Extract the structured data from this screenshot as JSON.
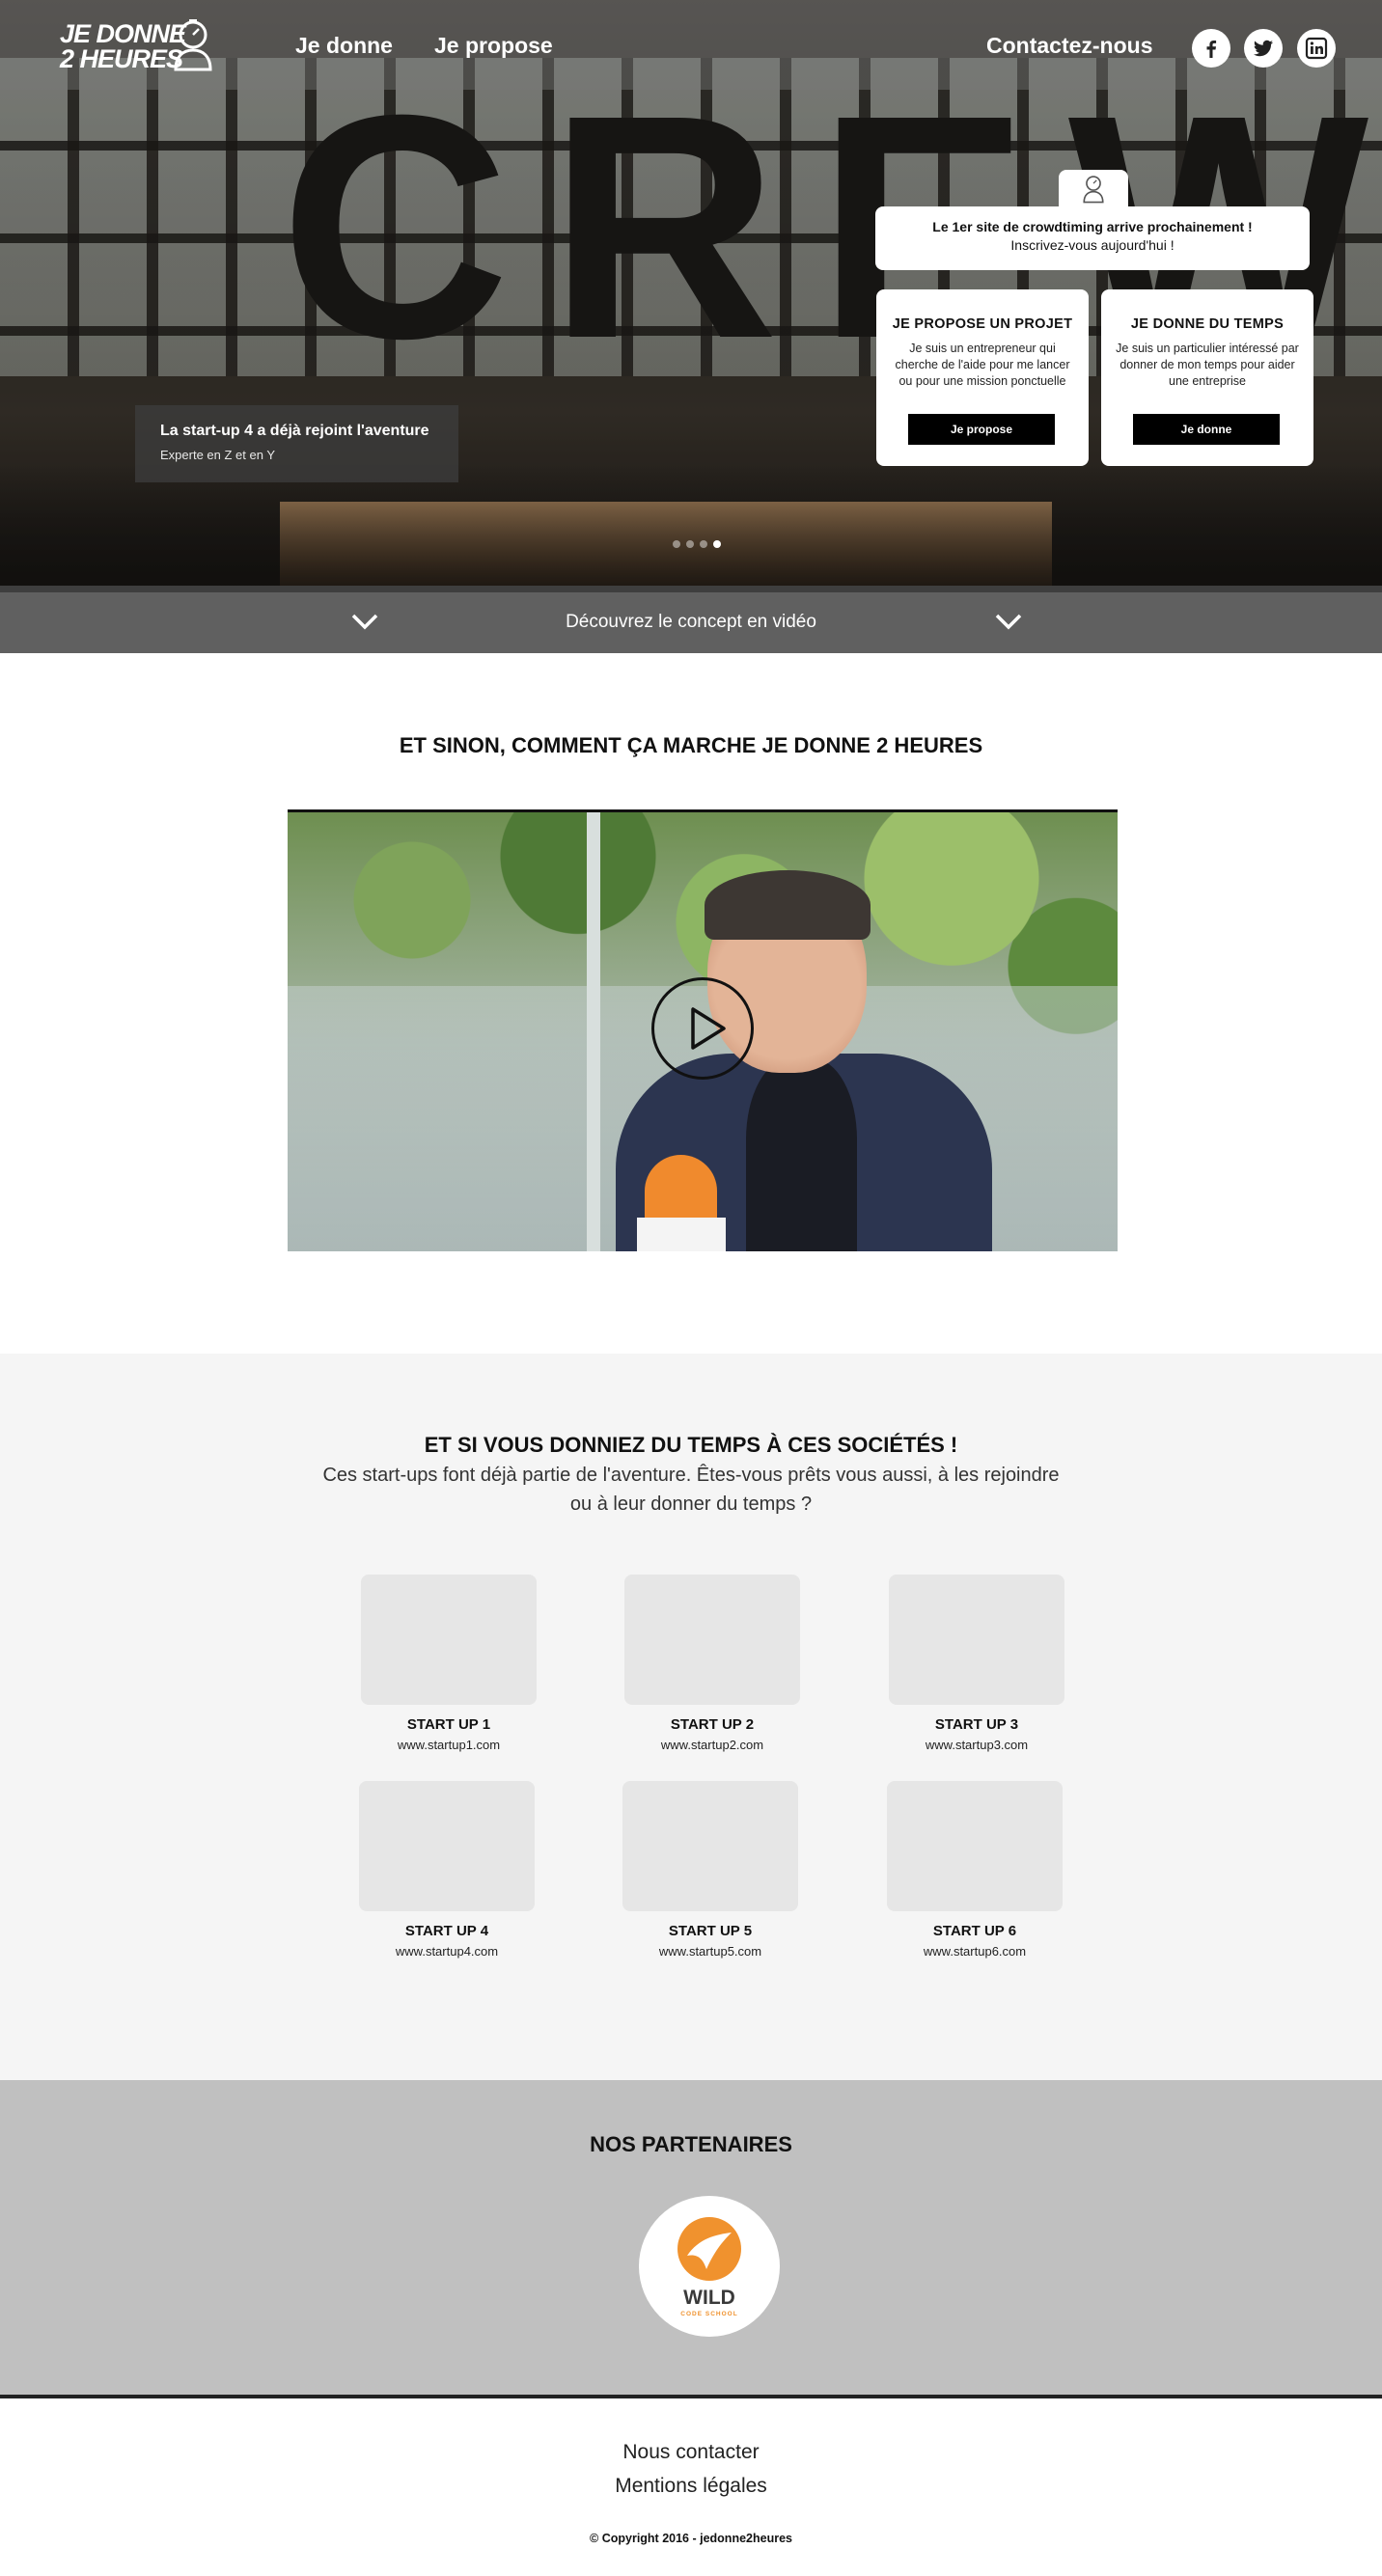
{
  "nav": {
    "logo_line1": "JE DONNE",
    "logo_line2": "2 HEURES",
    "links": [
      "Je donne",
      "Je propose"
    ],
    "contact": "Contactez-nous",
    "social": [
      "facebook-icon",
      "twitter-icon",
      "linkedin-icon"
    ]
  },
  "hero": {
    "background_word": "CREW",
    "caption_title": "La start-up 4 a déjà rejoint l'aventure",
    "caption_sub": "Experte en Z et en Y",
    "announce_title": "Le 1er site de crowdtiming arrive prochainement !",
    "announce_sub": "Inscrivez-vous aujourd'hui !",
    "cards": [
      {
        "title": "JE PROPOSE UN PROJET",
        "desc": "Je suis un entrepreneur qui cherche de l'aide pour me lancer ou pour une mission ponctuelle",
        "button": "Je propose"
      },
      {
        "title": "JE DONNE DU TEMPS",
        "desc": "Je suis un particulier intéressé par donner de mon temps pour aider une entreprise",
        "button": "Je donne"
      }
    ]
  },
  "video_bar": {
    "label": "Découvrez le concept en vidéo"
  },
  "how": {
    "title": "ET SINON, COMMENT ÇA MARCHE JE DONNE 2 HEURES"
  },
  "startups": {
    "title": "ET SI VOUS DONNIEZ DU TEMPS À CES SOCIÉTÉS !",
    "subtitle": "Ces start-ups font déjà partie de l'aventure. Êtes-vous prêts vous aussi,  à les rejoindre ou à leur donner du temps ?",
    "items": [
      {
        "name": "START UP 1",
        "url": "www.startup1.com"
      },
      {
        "name": "START UP 2",
        "url": "www.startup2.com"
      },
      {
        "name": "START UP 3",
        "url": "www.startup3.com"
      },
      {
        "name": "START UP 4",
        "url": "www.startup4.com"
      },
      {
        "name": "START UP 5",
        "url": "www.startup5.com"
      },
      {
        "name": "START UP 6",
        "url": "www.startup6.com"
      }
    ]
  },
  "partners": {
    "title": "NOS PARTENAIRES",
    "logo_word": "WILD",
    "logo_sub": "CODE SCHOOL"
  },
  "footer": {
    "contact": "Nous contacter",
    "legal": "Mentions légales",
    "copyright": "© Copyright 2016 - jedonne2heures"
  },
  "colors": {
    "accent_orange": "#f0922e",
    "dark_bar": "#606060",
    "light_bg": "#f5f5f5",
    "partner_bg": "#c0c0c0"
  }
}
